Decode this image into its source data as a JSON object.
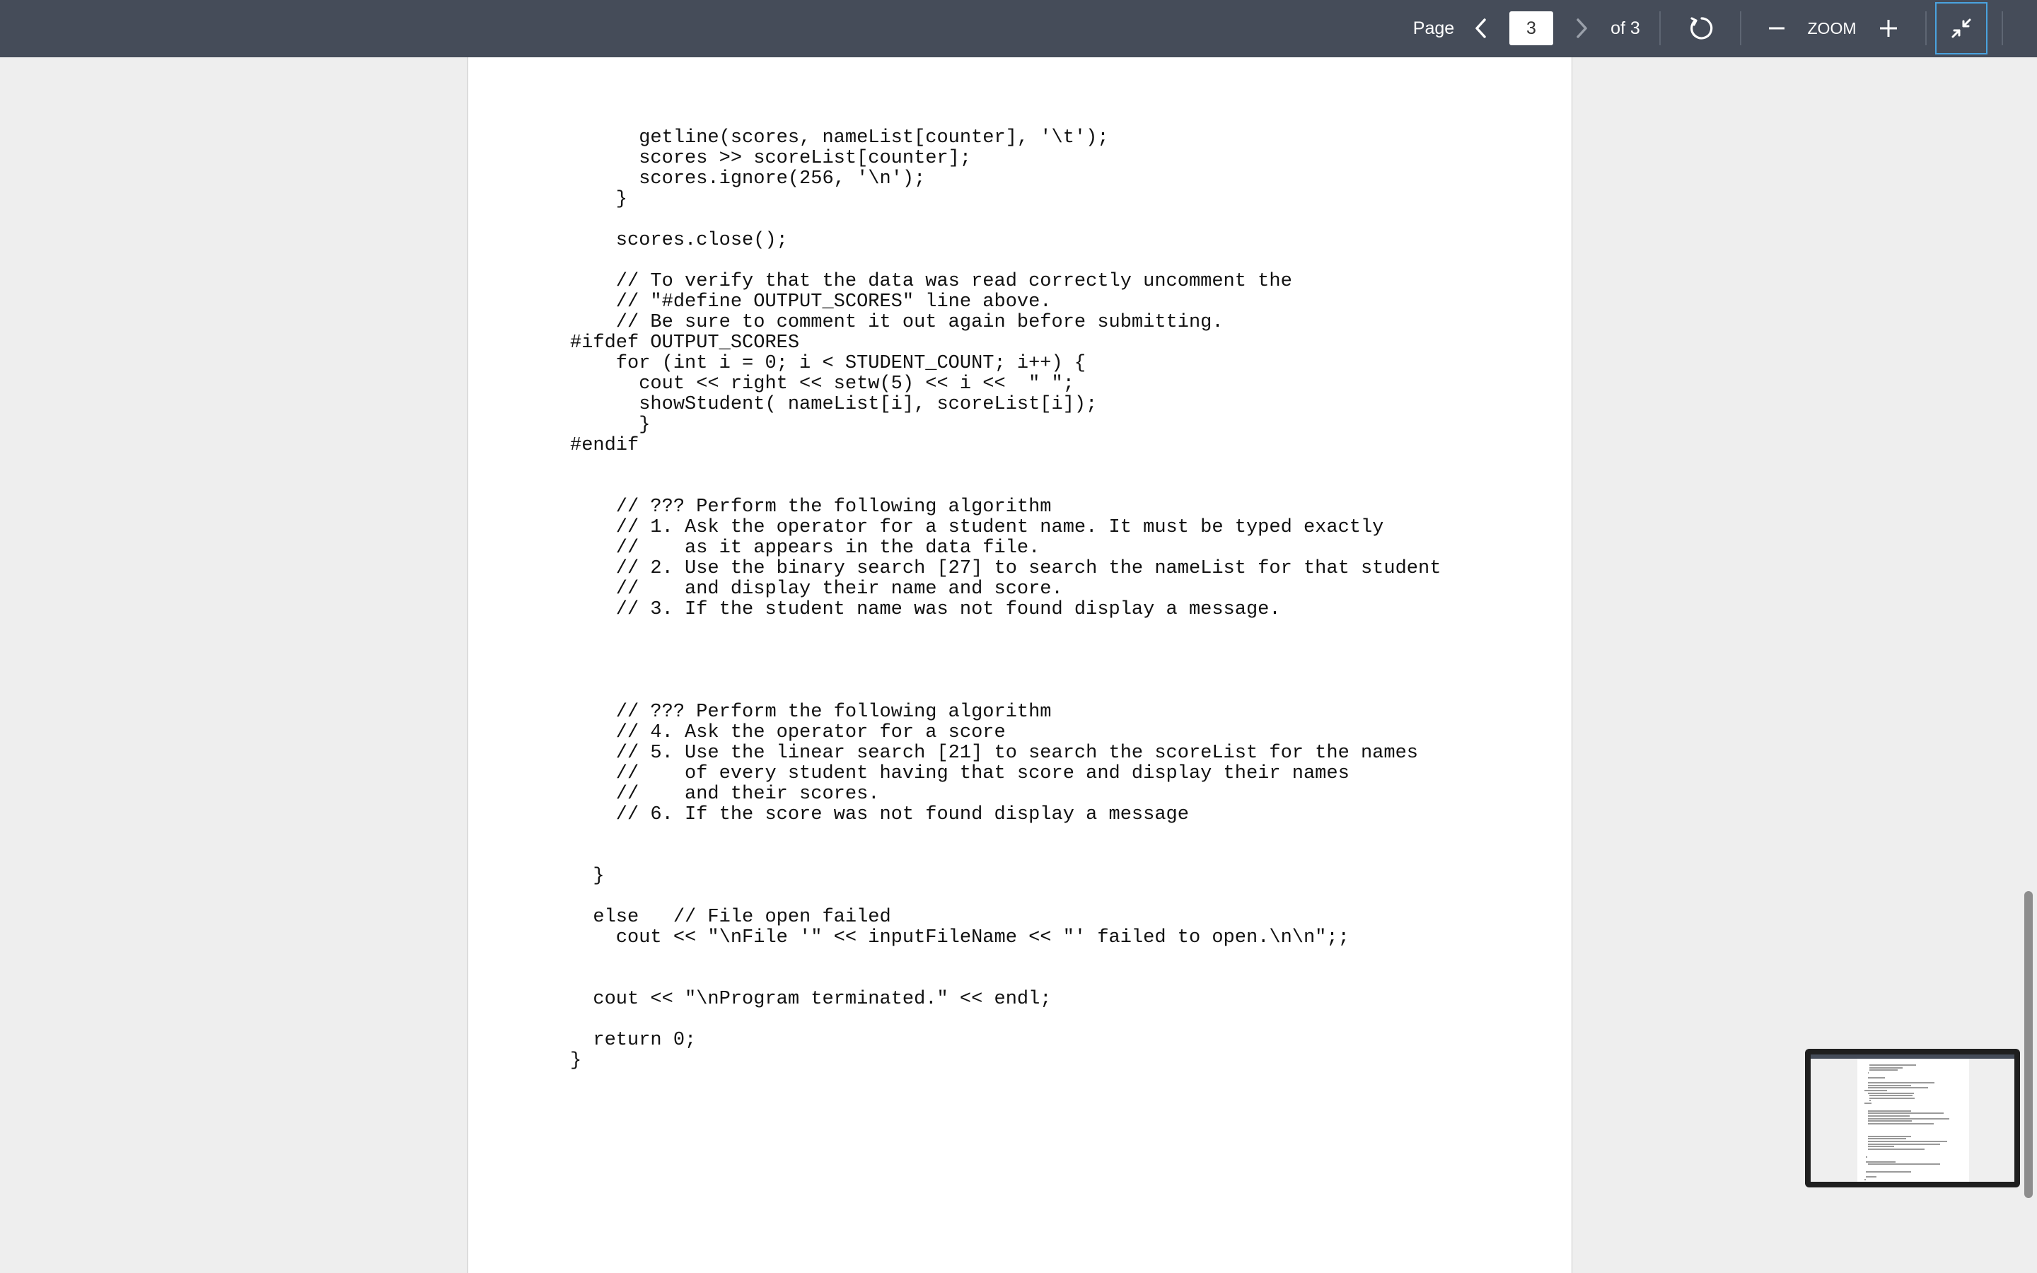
{
  "toolbar": {
    "page_label": "Page",
    "current_page": "3",
    "of_total": "of 3",
    "zoom_label": "ZOOM",
    "background_color": "#454c59",
    "active_outline_color": "#4aa3df",
    "icons": {
      "prev": "chevron-left-icon",
      "next": "chevron-right-icon",
      "rotate": "rotate-icon",
      "zoom_out": "minus-icon",
      "zoom_in": "plus-icon",
      "collapse": "collapse-icon"
    }
  },
  "document": {
    "code_lines": [
      "      getline(scores, nameList[counter], '\\t');",
      "      scores >> scoreList[counter];",
      "      scores.ignore(256, '\\n');",
      "    }",
      "",
      "    scores.close();",
      "",
      "    // To verify that the data was read correctly uncomment the",
      "    // \"#define OUTPUT_SCORES\" line above.",
      "    // Be sure to comment it out again before submitting.",
      "#ifdef OUTPUT_SCORES",
      "    for (int i = 0; i < STUDENT_COUNT; i++) {",
      "      cout << right << setw(5) << i <<  \" \";",
      "      showStudent( nameList[i], scoreList[i]);",
      "      }",
      "#endif",
      "",
      "",
      "    // ??? Perform the following algorithm",
      "    // 1. Ask the operator for a student name. It must be typed exactly",
      "    //    as it appears in the data file.",
      "    // 2. Use the binary search [27] to search the nameList for that student",
      "    //    and display their name and score.",
      "    // 3. If the student name was not found display a message.",
      "",
      "",
      "",
      "",
      "    // ??? Perform the following algorithm",
      "    // 4. Ask the operator for a score",
      "    // 5. Use the linear search [21] to search the scoreList for the names",
      "    //    of every student having that score and display their names",
      "    //    and their scores.",
      "    // 6. If the score was not found display a message",
      "",
      "",
      "  }",
      "",
      "  else   // File open failed",
      "    cout << \"\\nFile '\" << inputFileName << \"' failed to open.\\n\\n\";;",
      "",
      "",
      "  cout << \"\\nProgram terminated.\" << endl;",
      "",
      "  return 0;",
      "}"
    ]
  }
}
